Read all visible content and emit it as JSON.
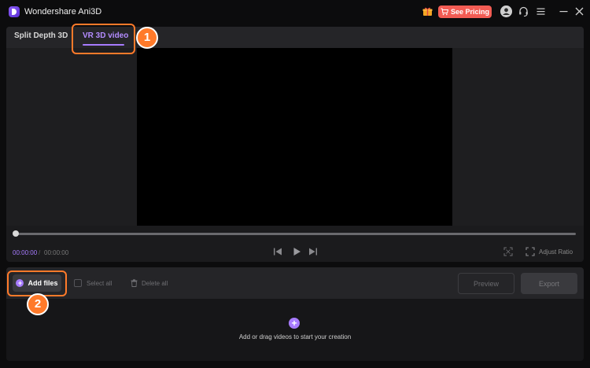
{
  "window": {
    "title": "Wondershare Ani3D",
    "pricing_label": "See Pricing"
  },
  "tabs": [
    {
      "label": "Split Depth 3D",
      "active": false
    },
    {
      "label": "VR 3D video",
      "active": true
    }
  ],
  "player": {
    "current_time": "00:00:00",
    "separator": "/",
    "total_time": "00:00:00",
    "adjust_ratio_label": "Adjust Ratio"
  },
  "file_toolbar": {
    "add_files_label": "Add files",
    "select_all_label": "Select all",
    "delete_all_label": "Delete all",
    "preview_label": "Preview",
    "export_label": "Export"
  },
  "drop_zone": {
    "hint": "Add or drag videos to start your creation"
  },
  "annotations": [
    {
      "number": "1"
    },
    {
      "number": "2"
    }
  ],
  "colors": {
    "accent": "#a77bff",
    "pricing": "#f25c54",
    "callout": "#ff7a2a",
    "background": "#0c0c0d"
  },
  "icons": {
    "logo": "app-logo-icon",
    "gift": "gift-icon",
    "cart": "cart-icon",
    "account": "avatar-icon",
    "support": "headset-icon",
    "menu": "hamburger-menu-icon",
    "minimize": "minimize-icon",
    "close": "close-icon",
    "previous": "skip-previous-icon",
    "play": "play-icon",
    "next": "skip-next-icon",
    "fullscreen": "fullscreen-icon",
    "adjust_ratio": "adjust-ratio-icon",
    "add": "plus-icon",
    "trash": "trash-icon"
  }
}
